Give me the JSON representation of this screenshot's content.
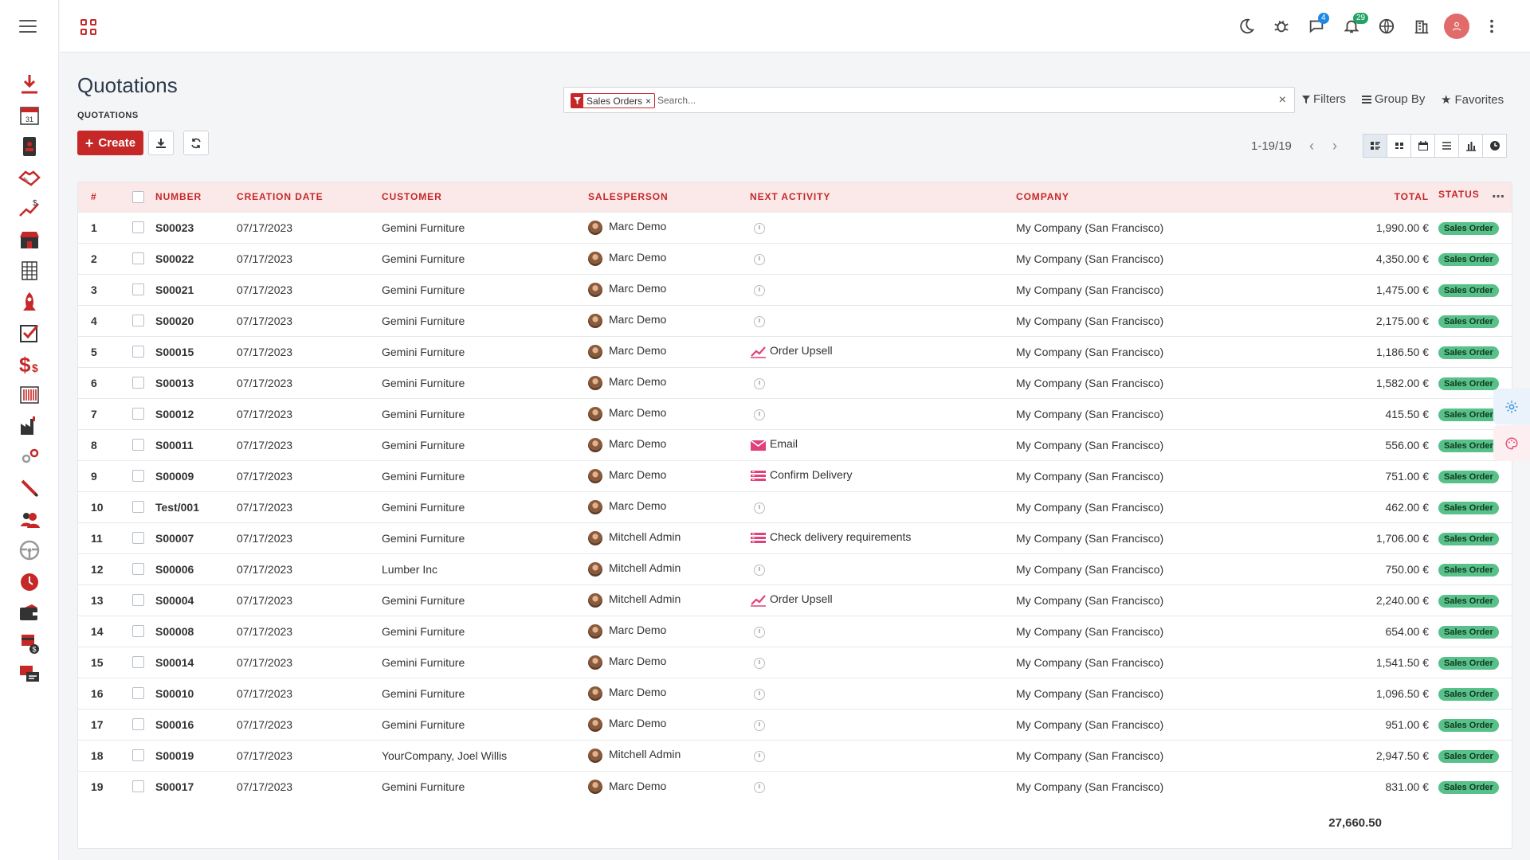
{
  "sidebar": {
    "icons": [
      "download-icon",
      "calendar-icon",
      "contacts-icon",
      "crm-handshake-icon",
      "sales-chart-icon",
      "pos-shop-icon",
      "spreadsheet-icon",
      "rocket-icon",
      "todo-check-icon",
      "invoicing-dollar-icon",
      "barcode-icon",
      "manufacturing-icon",
      "gears-icon",
      "pen-icon",
      "employees-icon",
      "steering-wheel-icon",
      "timer-icon",
      "wallet-icon",
      "expenses-icon",
      "livechat-icon"
    ],
    "calendar_day": "31"
  },
  "topbar": {
    "icons": [
      "moon-icon",
      "bug-icon",
      "chat-icon",
      "bell-icon",
      "globe-icon",
      "company-building-icon",
      "user-avatar-icon",
      "kebab-menu-icon"
    ],
    "chat_badge": "4",
    "bell_badge": "29"
  },
  "page": {
    "title": "Quotations",
    "breadcrumb": "QUOTATIONS",
    "create_label": "Create"
  },
  "search": {
    "facet_label": "Sales Orders",
    "placeholder": "Search...",
    "filters_label": "Filters",
    "groupby_label": "Group By",
    "favorites_label": "Favorites"
  },
  "pager": {
    "text": "1-19/19"
  },
  "table": {
    "headers": {
      "idx": "#",
      "number": "NUMBER",
      "date": "CREATION DATE",
      "customer": "CUSTOMER",
      "salesperson": "SALESPERSON",
      "activity": "NEXT ACTIVITY",
      "company": "COMPANY",
      "total": "TOTAL",
      "status": "STATUS"
    },
    "rows": [
      {
        "idx": "1",
        "number": "S00023",
        "date": "07/17/2023",
        "customer": "Gemini Furniture",
        "salesperson": "Marc Demo",
        "activity": "",
        "activity_icon": "",
        "company": "My Company (San Francisco)",
        "total": "1,990.00 €",
        "status": "Sales Order"
      },
      {
        "idx": "2",
        "number": "S00022",
        "date": "07/17/2023",
        "customer": "Gemini Furniture",
        "salesperson": "Marc Demo",
        "activity": "",
        "activity_icon": "",
        "company": "My Company (San Francisco)",
        "total": "4,350.00 €",
        "status": "Sales Order"
      },
      {
        "idx": "3",
        "number": "S00021",
        "date": "07/17/2023",
        "customer": "Gemini Furniture",
        "salesperson": "Marc Demo",
        "activity": "",
        "activity_icon": "",
        "company": "My Company (San Francisco)",
        "total": "1,475.00 €",
        "status": "Sales Order"
      },
      {
        "idx": "4",
        "number": "S00020",
        "date": "07/17/2023",
        "customer": "Gemini Furniture",
        "salesperson": "Marc Demo",
        "activity": "",
        "activity_icon": "",
        "company": "My Company (San Francisco)",
        "total": "2,175.00 €",
        "status": "Sales Order"
      },
      {
        "idx": "5",
        "number": "S00015",
        "date": "07/17/2023",
        "customer": "Gemini Furniture",
        "salesperson": "Marc Demo",
        "activity": "Order Upsell",
        "activity_icon": "trend",
        "company": "My Company (San Francisco)",
        "total": "1,186.50 €",
        "status": "Sales Order"
      },
      {
        "idx": "6",
        "number": "S00013",
        "date": "07/17/2023",
        "customer": "Gemini Furniture",
        "salesperson": "Marc Demo",
        "activity": "",
        "activity_icon": "",
        "company": "My Company (San Francisco)",
        "total": "1,582.00 €",
        "status": "Sales Order"
      },
      {
        "idx": "7",
        "number": "S00012",
        "date": "07/17/2023",
        "customer": "Gemini Furniture",
        "salesperson": "Marc Demo",
        "activity": "",
        "activity_icon": "",
        "company": "My Company (San Francisco)",
        "total": "415.50 €",
        "status": "Sales Order"
      },
      {
        "idx": "8",
        "number": "S00011",
        "date": "07/17/2023",
        "customer": "Gemini Furniture",
        "salesperson": "Marc Demo",
        "activity": "Email",
        "activity_icon": "email",
        "company": "My Company (San Francisco)",
        "total": "556.00 €",
        "status": "Sales Order"
      },
      {
        "idx": "9",
        "number": "S00009",
        "date": "07/17/2023",
        "customer": "Gemini Furniture",
        "salesperson": "Marc Demo",
        "activity": "Confirm Delivery",
        "activity_icon": "todo",
        "company": "My Company (San Francisco)",
        "total": "751.00 €",
        "status": "Sales Order"
      },
      {
        "idx": "10",
        "number": "Test/001",
        "date": "07/17/2023",
        "customer": "Gemini Furniture",
        "salesperson": "Marc Demo",
        "activity": "",
        "activity_icon": "",
        "company": "My Company (San Francisco)",
        "total": "462.00 €",
        "status": "Sales Order"
      },
      {
        "idx": "11",
        "number": "S00007",
        "date": "07/17/2023",
        "customer": "Gemini Furniture",
        "salesperson": "Mitchell Admin",
        "activity": "Check delivery requirements",
        "activity_icon": "todo",
        "company": "My Company (San Francisco)",
        "total": "1,706.00 €",
        "status": "Sales Order"
      },
      {
        "idx": "12",
        "number": "S00006",
        "date": "07/17/2023",
        "customer": "Lumber Inc",
        "salesperson": "Mitchell Admin",
        "activity": "",
        "activity_icon": "",
        "company": "My Company (San Francisco)",
        "total": "750.00 €",
        "status": "Sales Order"
      },
      {
        "idx": "13",
        "number": "S00004",
        "date": "07/17/2023",
        "customer": "Gemini Furniture",
        "salesperson": "Mitchell Admin",
        "activity": "Order Upsell",
        "activity_icon": "trend",
        "company": "My Company (San Francisco)",
        "total": "2,240.00 €",
        "status": "Sales Order"
      },
      {
        "idx": "14",
        "number": "S00008",
        "date": "07/17/2023",
        "customer": "Gemini Furniture",
        "salesperson": "Marc Demo",
        "activity": "",
        "activity_icon": "",
        "company": "My Company (San Francisco)",
        "total": "654.00 €",
        "status": "Sales Order"
      },
      {
        "idx": "15",
        "number": "S00014",
        "date": "07/17/2023",
        "customer": "Gemini Furniture",
        "salesperson": "Marc Demo",
        "activity": "",
        "activity_icon": "",
        "company": "My Company (San Francisco)",
        "total": "1,541.50 €",
        "status": "Sales Order"
      },
      {
        "idx": "16",
        "number": "S00010",
        "date": "07/17/2023",
        "customer": "Gemini Furniture",
        "salesperson": "Marc Demo",
        "activity": "",
        "activity_icon": "",
        "company": "My Company (San Francisco)",
        "total": "1,096.50 €",
        "status": "Sales Order"
      },
      {
        "idx": "17",
        "number": "S00016",
        "date": "07/17/2023",
        "customer": "Gemini Furniture",
        "salesperson": "Marc Demo",
        "activity": "",
        "activity_icon": "",
        "company": "My Company (San Francisco)",
        "total": "951.00 €",
        "status": "Sales Order"
      },
      {
        "idx": "18",
        "number": "S00019",
        "date": "07/17/2023",
        "customer": "YourCompany, Joel Willis",
        "salesperson": "Mitchell Admin",
        "activity": "",
        "activity_icon": "",
        "company": "My Company (San Francisco)",
        "total": "2,947.50 €",
        "status": "Sales Order"
      },
      {
        "idx": "19",
        "number": "S00017",
        "date": "07/17/2023",
        "customer": "Gemini Furniture",
        "salesperson": "Marc Demo",
        "activity": "",
        "activity_icon": "",
        "company": "My Company (San Francisco)",
        "total": "831.00 €",
        "status": "Sales Order"
      }
    ],
    "grand_total": "27,660.50"
  },
  "colors": {
    "accent": "#c62828",
    "status_green": "#58c18a"
  }
}
